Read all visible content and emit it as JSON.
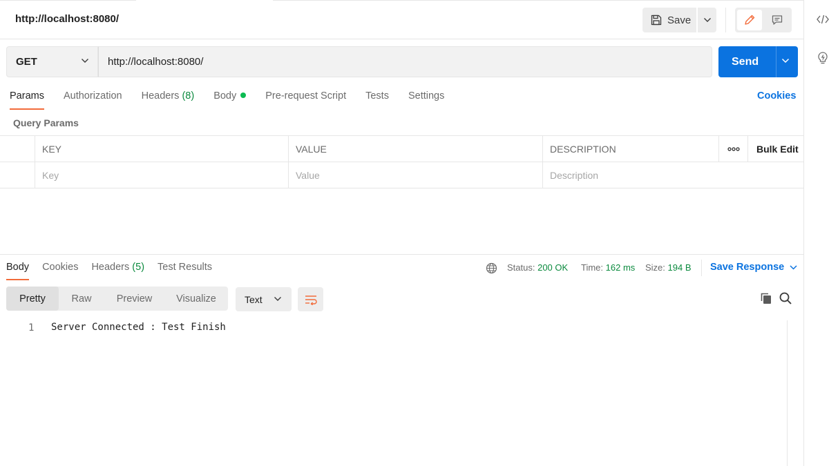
{
  "header": {
    "request_title": "http://localhost:8080/",
    "save_label": "Save"
  },
  "request": {
    "method": "GET",
    "url": "http://localhost:8080/",
    "send_label": "Send"
  },
  "request_tabs": [
    {
      "label": "Params"
    },
    {
      "label": "Authorization"
    },
    {
      "label": "Headers",
      "count": "(8)"
    },
    {
      "label": "Body"
    },
    {
      "label": "Pre-request Script"
    },
    {
      "label": "Tests"
    },
    {
      "label": "Settings"
    }
  ],
  "cookies_label": "Cookies",
  "query_params": {
    "title": "Query Params",
    "columns": [
      "KEY",
      "VALUE",
      "DESCRIPTION"
    ],
    "bulk_edit_label": "Bulk Edit",
    "placeholders": {
      "key": "Key",
      "value": "Value",
      "description": "Description"
    }
  },
  "response": {
    "tabs": [
      {
        "label": "Body"
      },
      {
        "label": "Cookies"
      },
      {
        "label": "Headers",
        "count": "(5)"
      },
      {
        "label": "Test Results"
      }
    ],
    "status_label": "Status:",
    "status_value": "200 OK",
    "time_label": "Time:",
    "time_value": "162 ms",
    "size_label": "Size:",
    "size_value": "194 B",
    "save_response_label": "Save Response",
    "views": [
      "Pretty",
      "Raw",
      "Preview",
      "Visualize"
    ],
    "format": "Text",
    "lines": [
      {
        "number": "1",
        "text": "Server Connected : Test Finish"
      }
    ]
  },
  "colors": {
    "accent": "#f26b3a",
    "primary": "#0b73e0",
    "success": "#0b8a3e"
  }
}
